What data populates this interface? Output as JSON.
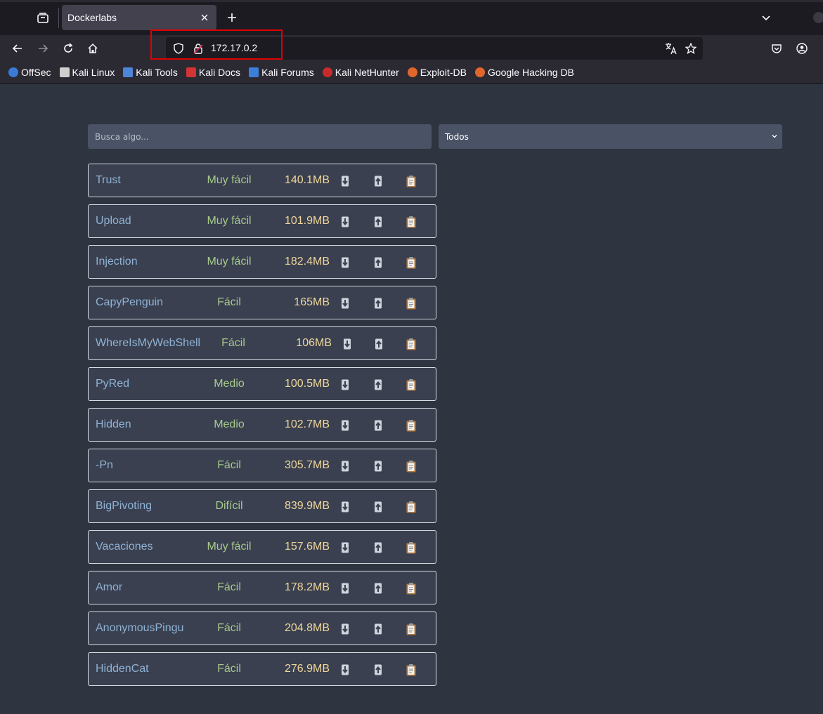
{
  "browser": {
    "tab_title": "Dockerlabs",
    "url": "172.17.0.2",
    "bookmarks": [
      {
        "label": "OffSec",
        "color": "#3a7bd5"
      },
      {
        "label": "Kali Linux",
        "color": "#cfcfcf"
      },
      {
        "label": "Kali Tools",
        "color": "#4d86d6"
      },
      {
        "label": "Kali Docs",
        "color": "#d23333"
      },
      {
        "label": "Kali Forums",
        "color": "#3d7fd8"
      },
      {
        "label": "Kali NetHunter",
        "color": "#c92a2a"
      },
      {
        "label": "Exploit-DB",
        "color": "#e0662c"
      },
      {
        "label": "Google Hacking DB",
        "color": "#e0662c"
      }
    ]
  },
  "search": {
    "placeholder": "Busca algo..."
  },
  "filter": {
    "selected": "Todos"
  },
  "machines": [
    {
      "name": "Trust",
      "difficulty": "Muy fácil",
      "size": "140.1MB"
    },
    {
      "name": "Upload",
      "difficulty": "Muy fácil",
      "size": "101.9MB"
    },
    {
      "name": "Injection",
      "difficulty": "Muy fácil",
      "size": "182.4MB"
    },
    {
      "name": "CapyPenguin",
      "difficulty": "Fácil",
      "size": "165MB"
    },
    {
      "name": "WhereIsMyWebShell",
      "difficulty": "Fácil",
      "size": "106MB"
    },
    {
      "name": "PyRed",
      "difficulty": "Medio",
      "size": "100.5MB"
    },
    {
      "name": "Hidden",
      "difficulty": "Medio",
      "size": "102.7MB"
    },
    {
      "name": "-Pn",
      "difficulty": "Fácil",
      "size": "305.7MB"
    },
    {
      "name": "BigPivoting",
      "difficulty": "Difícil",
      "size": "839.9MB"
    },
    {
      "name": "Vacaciones",
      "difficulty": "Muy fácil",
      "size": "157.6MB"
    },
    {
      "name": "Amor",
      "difficulty": "Fácil",
      "size": "178.2MB"
    },
    {
      "name": "AnonymousPingu",
      "difficulty": "Fácil",
      "size": "204.8MB"
    },
    {
      "name": "HiddenCat",
      "difficulty": "Fácil",
      "size": "276.9MB"
    }
  ],
  "row_actions": {
    "download_icon": "down-arrow-icon",
    "upload_icon": "up-arrow-icon",
    "writeup_icon": "clipboard-icon"
  }
}
